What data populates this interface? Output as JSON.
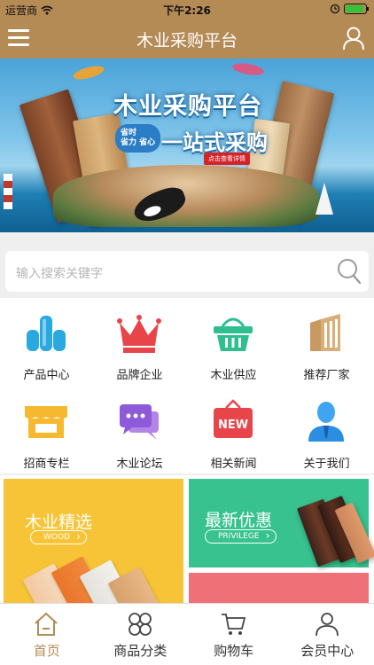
{
  "status_bar": {
    "carrier": "运营商",
    "time": "下午2:26",
    "battery_level": 0.9
  },
  "header": {
    "title": "木业采购平台"
  },
  "banner": {
    "headline": "木业采购平台",
    "sub": "一站式采购",
    "tag_line1": "省时",
    "tag_line2": "省力 省心",
    "cta": "点击查看详情"
  },
  "search": {
    "placeholder": "输入搜索关键字"
  },
  "categories": [
    {
      "label": "产品中心",
      "icon": "products-icon",
      "color": "#2aa8e0"
    },
    {
      "label": "品牌企业",
      "icon": "crown-icon",
      "color": "#e8454a"
    },
    {
      "label": "木业供应",
      "icon": "basket-icon",
      "color": "#2fbf8e"
    },
    {
      "label": "推荐厂家",
      "icon": "factory-icon",
      "color": "#c89a62"
    },
    {
      "label": "招商专栏",
      "icon": "store-icon",
      "color": "#f5b82e"
    },
    {
      "label": "木业论坛",
      "icon": "chat-icon",
      "color": "#8f5ad9"
    },
    {
      "label": "相关新闻",
      "icon": "news-icon",
      "color": "#e8454a"
    },
    {
      "label": "关于我们",
      "icon": "person-icon",
      "color": "#2a8fe0"
    }
  ],
  "promos": {
    "left": {
      "title": "木业精选",
      "tag": "WOOD"
    },
    "right": {
      "title": "最新优惠",
      "tag": "PRIVILEGE"
    }
  },
  "tabbar": [
    {
      "label": "首页",
      "icon": "home-icon",
      "active": true
    },
    {
      "label": "商品分类",
      "icon": "category-icon",
      "active": false
    },
    {
      "label": "购物车",
      "icon": "cart-icon",
      "active": false
    },
    {
      "label": "会员中心",
      "icon": "member-icon",
      "active": false
    }
  ],
  "colors": {
    "brand": "#b48a55",
    "active_tab": "#b48a55"
  }
}
